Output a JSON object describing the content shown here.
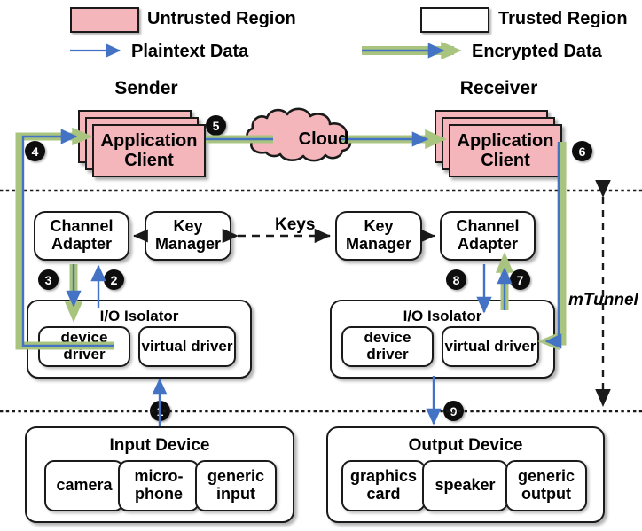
{
  "legend": {
    "items": [
      {
        "id": "untrusted",
        "label": "Untrusted Region",
        "kind": "swatch",
        "color": "#F4B6BB"
      },
      {
        "id": "trusted",
        "label": "Trusted Region",
        "kind": "swatch",
        "color": "#FFFFFF"
      },
      {
        "id": "plaintext",
        "label": "Plaintext Data",
        "kind": "arrow",
        "color": "#4472C4"
      },
      {
        "id": "encrypted",
        "label": "Encrypted Data",
        "kind": "arrow",
        "color": "#4472C4",
        "outline": "#A9C47F"
      }
    ]
  },
  "headings": {
    "sender": "Sender",
    "receiver": "Receiver"
  },
  "nodes": {
    "sender_app_client": "Application Client",
    "receiver_app_client": "Application Client",
    "cloud": "Cloud",
    "sender_channel_adapter": "Channel Adapter",
    "sender_key_manager": "Key Manager",
    "receiver_key_manager": "Key Manager",
    "receiver_channel_adapter": "Channel Adapter",
    "sender_io_isolator": "I/O Isolator",
    "receiver_io_isolator": "I/O Isolator",
    "sender_device_driver": "device driver",
    "sender_virtual_driver": "virtual driver",
    "receiver_device_driver": "device driver",
    "receiver_virtual_driver": "virtual driver",
    "input_device": "Input Device",
    "output_device": "Output Device",
    "camera": "camera",
    "microphone": "micro- phone",
    "generic_input": "generic input",
    "graphics_card": "graphics card",
    "speaker": "speaker",
    "generic_output": "generic output"
  },
  "labels": {
    "keys": "Keys",
    "mtunnel": "mTunnel"
  },
  "step_badges": [
    {
      "n": "1"
    },
    {
      "n": "2"
    },
    {
      "n": "3"
    },
    {
      "n": "4"
    },
    {
      "n": "5"
    },
    {
      "n": "6"
    },
    {
      "n": "7"
    },
    {
      "n": "8"
    },
    {
      "n": "9"
    }
  ],
  "colors": {
    "untrusted_fill": "#F4B6BB",
    "trusted_fill": "#FFFFFF",
    "stroke": "#1A1A1A",
    "plaintext_arrow": "#4472C4",
    "encrypted_outline": "#A9C47F",
    "badge_fill": "#0D0D0D"
  }
}
